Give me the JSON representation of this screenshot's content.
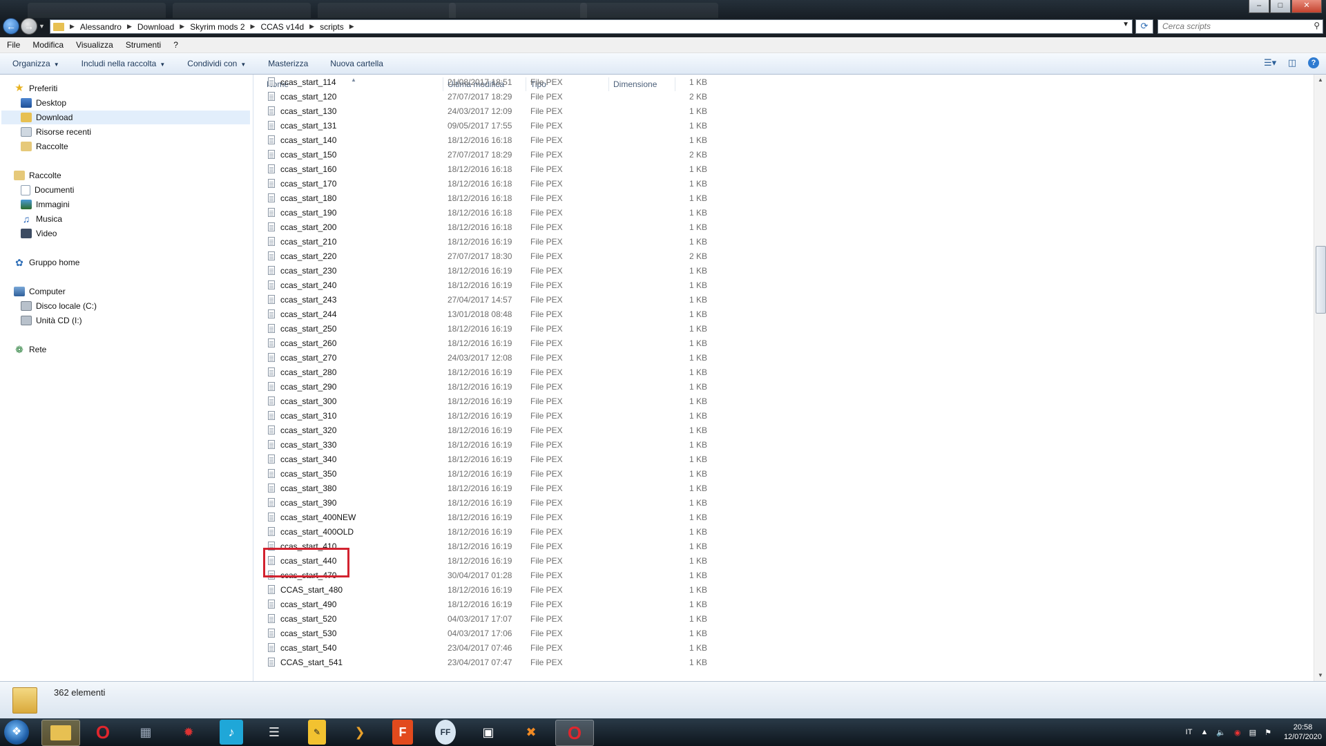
{
  "titlebar": {
    "window_buttons": {
      "minimize": "–",
      "maximize": "□",
      "close": "✕"
    }
  },
  "address": {
    "crumbs": [
      "Alessandro",
      "Download",
      "Skyrim mods 2",
      "CCAS v14d",
      "scripts"
    ],
    "search_placeholder": "Cerca scripts"
  },
  "menubar": [
    "File",
    "Modifica",
    "Visualizza",
    "Strumenti",
    "?"
  ],
  "toolbar": {
    "organizza": "Organizza",
    "includi": "Includi nella raccolta",
    "condividi": "Condividi con",
    "masterizza": "Masterizza",
    "nuova_cartella": "Nuova cartella"
  },
  "nav": {
    "preferiti": "Preferiti",
    "desktop": "Desktop",
    "download": "Download",
    "risorse_recenti": "Risorse recenti",
    "raccolte_fav": "Raccolte",
    "raccolte": "Raccolte",
    "documenti": "Documenti",
    "immagini": "Immagini",
    "musica": "Musica",
    "video": "Video",
    "gruppo_home": "Gruppo home",
    "computer": "Computer",
    "disco_c": "Disco locale (C:)",
    "unita_cd": "Unità CD (I:)",
    "rete": "Rete"
  },
  "columns": {
    "name": "Nome",
    "modified": "Ultima modifica",
    "type": "Tipo",
    "size": "Dimensione"
  },
  "files": [
    {
      "name": "ccas_start_114",
      "date": "21/08/2017 18:51",
      "type": "File PEX",
      "size": "1 KB"
    },
    {
      "name": "ccas_start_120",
      "date": "27/07/2017 18:29",
      "type": "File PEX",
      "size": "2 KB"
    },
    {
      "name": "ccas_start_130",
      "date": "24/03/2017 12:09",
      "type": "File PEX",
      "size": "1 KB"
    },
    {
      "name": "ccas_start_131",
      "date": "09/05/2017 17:55",
      "type": "File PEX",
      "size": "1 KB"
    },
    {
      "name": "ccas_start_140",
      "date": "18/12/2016 16:18",
      "type": "File PEX",
      "size": "1 KB"
    },
    {
      "name": "ccas_start_150",
      "date": "27/07/2017 18:29",
      "type": "File PEX",
      "size": "2 KB"
    },
    {
      "name": "ccas_start_160",
      "date": "18/12/2016 16:18",
      "type": "File PEX",
      "size": "1 KB"
    },
    {
      "name": "ccas_start_170",
      "date": "18/12/2016 16:18",
      "type": "File PEX",
      "size": "1 KB"
    },
    {
      "name": "ccas_start_180",
      "date": "18/12/2016 16:18",
      "type": "File PEX",
      "size": "1 KB"
    },
    {
      "name": "ccas_start_190",
      "date": "18/12/2016 16:18",
      "type": "File PEX",
      "size": "1 KB"
    },
    {
      "name": "ccas_start_200",
      "date": "18/12/2016 16:18",
      "type": "File PEX",
      "size": "1 KB"
    },
    {
      "name": "ccas_start_210",
      "date": "18/12/2016 16:19",
      "type": "File PEX",
      "size": "1 KB"
    },
    {
      "name": "ccas_start_220",
      "date": "27/07/2017 18:30",
      "type": "File PEX",
      "size": "2 KB"
    },
    {
      "name": "ccas_start_230",
      "date": "18/12/2016 16:19",
      "type": "File PEX",
      "size": "1 KB"
    },
    {
      "name": "ccas_start_240",
      "date": "18/12/2016 16:19",
      "type": "File PEX",
      "size": "1 KB"
    },
    {
      "name": "ccas_start_243",
      "date": "27/04/2017 14:57",
      "type": "File PEX",
      "size": "1 KB"
    },
    {
      "name": "ccas_start_244",
      "date": "13/01/2018 08:48",
      "type": "File PEX",
      "size": "1 KB"
    },
    {
      "name": "ccas_start_250",
      "date": "18/12/2016 16:19",
      "type": "File PEX",
      "size": "1 KB"
    },
    {
      "name": "ccas_start_260",
      "date": "18/12/2016 16:19",
      "type": "File PEX",
      "size": "1 KB"
    },
    {
      "name": "ccas_start_270",
      "date": "24/03/2017 12:08",
      "type": "File PEX",
      "size": "1 KB"
    },
    {
      "name": "ccas_start_280",
      "date": "18/12/2016 16:19",
      "type": "File PEX",
      "size": "1 KB"
    },
    {
      "name": "ccas_start_290",
      "date": "18/12/2016 16:19",
      "type": "File PEX",
      "size": "1 KB"
    },
    {
      "name": "ccas_start_300",
      "date": "18/12/2016 16:19",
      "type": "File PEX",
      "size": "1 KB"
    },
    {
      "name": "ccas_start_310",
      "date": "18/12/2016 16:19",
      "type": "File PEX",
      "size": "1 KB"
    },
    {
      "name": "ccas_start_320",
      "date": "18/12/2016 16:19",
      "type": "File PEX",
      "size": "1 KB"
    },
    {
      "name": "ccas_start_330",
      "date": "18/12/2016 16:19",
      "type": "File PEX",
      "size": "1 KB"
    },
    {
      "name": "ccas_start_340",
      "date": "18/12/2016 16:19",
      "type": "File PEX",
      "size": "1 KB"
    },
    {
      "name": "ccas_start_350",
      "date": "18/12/2016 16:19",
      "type": "File PEX",
      "size": "1 KB"
    },
    {
      "name": "ccas_start_380",
      "date": "18/12/2016 16:19",
      "type": "File PEX",
      "size": "1 KB"
    },
    {
      "name": "ccas_start_390",
      "date": "18/12/2016 16:19",
      "type": "File PEX",
      "size": "1 KB"
    },
    {
      "name": "ccas_start_400NEW",
      "date": "18/12/2016 16:19",
      "type": "File PEX",
      "size": "1 KB"
    },
    {
      "name": "ccas_start_400OLD",
      "date": "18/12/2016 16:19",
      "type": "File PEX",
      "size": "1 KB"
    },
    {
      "name": "ccas_start_410",
      "date": "18/12/2016 16:19",
      "type": "File PEX",
      "size": "1 KB"
    },
    {
      "name": "ccas_start_440",
      "date": "18/12/2016 16:19",
      "type": "File PEX",
      "size": "1 KB"
    },
    {
      "name": "ccas_start_470",
      "date": "30/04/2017 01:28",
      "type": "File PEX",
      "size": "1 KB"
    },
    {
      "name": "CCAS_start_480",
      "date": "18/12/2016 16:19",
      "type": "File PEX",
      "size": "1 KB"
    },
    {
      "name": "ccas_start_490",
      "date": "18/12/2016 16:19",
      "type": "File PEX",
      "size": "1 KB"
    },
    {
      "name": "ccas_start_520",
      "date": "04/03/2017 17:07",
      "type": "File PEX",
      "size": "1 KB"
    },
    {
      "name": "ccas_start_530",
      "date": "04/03/2017 17:06",
      "type": "File PEX",
      "size": "1 KB"
    },
    {
      "name": "ccas_start_540",
      "date": "23/04/2017 07:46",
      "type": "File PEX",
      "size": "1 KB"
    },
    {
      "name": "CCAS_start_541",
      "date": "23/04/2017 07:47",
      "type": "File PEX",
      "size": "1 KB"
    }
  ],
  "status": {
    "count": "362 elementi"
  },
  "taskbar": {
    "tray_lang": "IT",
    "time": "20:58",
    "date": "12/07/2020"
  },
  "colors": {
    "highlight": "#d2222f",
    "selection": "#e2eefb"
  }
}
